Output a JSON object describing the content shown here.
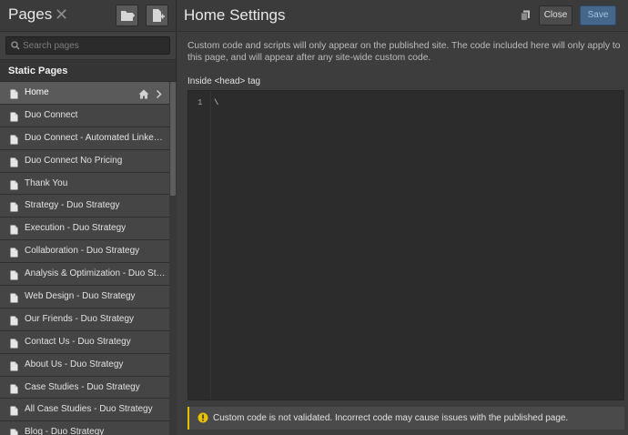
{
  "left_panel": {
    "title": "Pages",
    "search_placeholder": "Search pages",
    "section_title": "Static Pages",
    "pages": [
      {
        "label": "Home",
        "active": true
      },
      {
        "label": "Duo Connect"
      },
      {
        "label": "Duo Connect - Automated LinkedIn Outreach"
      },
      {
        "label": "Duo Connect No Pricing"
      },
      {
        "label": "Thank You"
      },
      {
        "label": "Strategy - Duo Strategy"
      },
      {
        "label": "Execution - Duo Strategy"
      },
      {
        "label": "Collaboration - Duo Strategy"
      },
      {
        "label": "Analysis & Optimization - Duo Strategy"
      },
      {
        "label": "Web Design - Duo Strategy"
      },
      {
        "label": "Our Friends - Duo Strategy"
      },
      {
        "label": "Contact Us - Duo Strategy"
      },
      {
        "label": "About Us - Duo Strategy"
      },
      {
        "label": "Case Studies - Duo Strategy"
      },
      {
        "label": "All Case Studies - Duo Strategy"
      },
      {
        "label": "Blog - Duo Strategy"
      }
    ]
  },
  "right_panel": {
    "title": "Home Settings",
    "close_label": "Close",
    "save_label": "Save",
    "description": "Custom code and scripts will only appear on the published site. The code included here will only apply to this page, and will appear after any site-wide custom code.",
    "code_label": "Inside <head> tag",
    "editor": {
      "line_number": "1",
      "content": "\\"
    },
    "warning": "Custom code is not validated. Incorrect code may cause issues with the published page."
  },
  "colors": {
    "accent_save": "#45678c",
    "warning": "#e5c000"
  },
  "icons": [
    "close-icon",
    "add-folder-icon",
    "add-page-icon",
    "search-icon",
    "document-icon",
    "home-icon",
    "chevron-right-icon",
    "copy-icon",
    "warning-icon"
  ]
}
